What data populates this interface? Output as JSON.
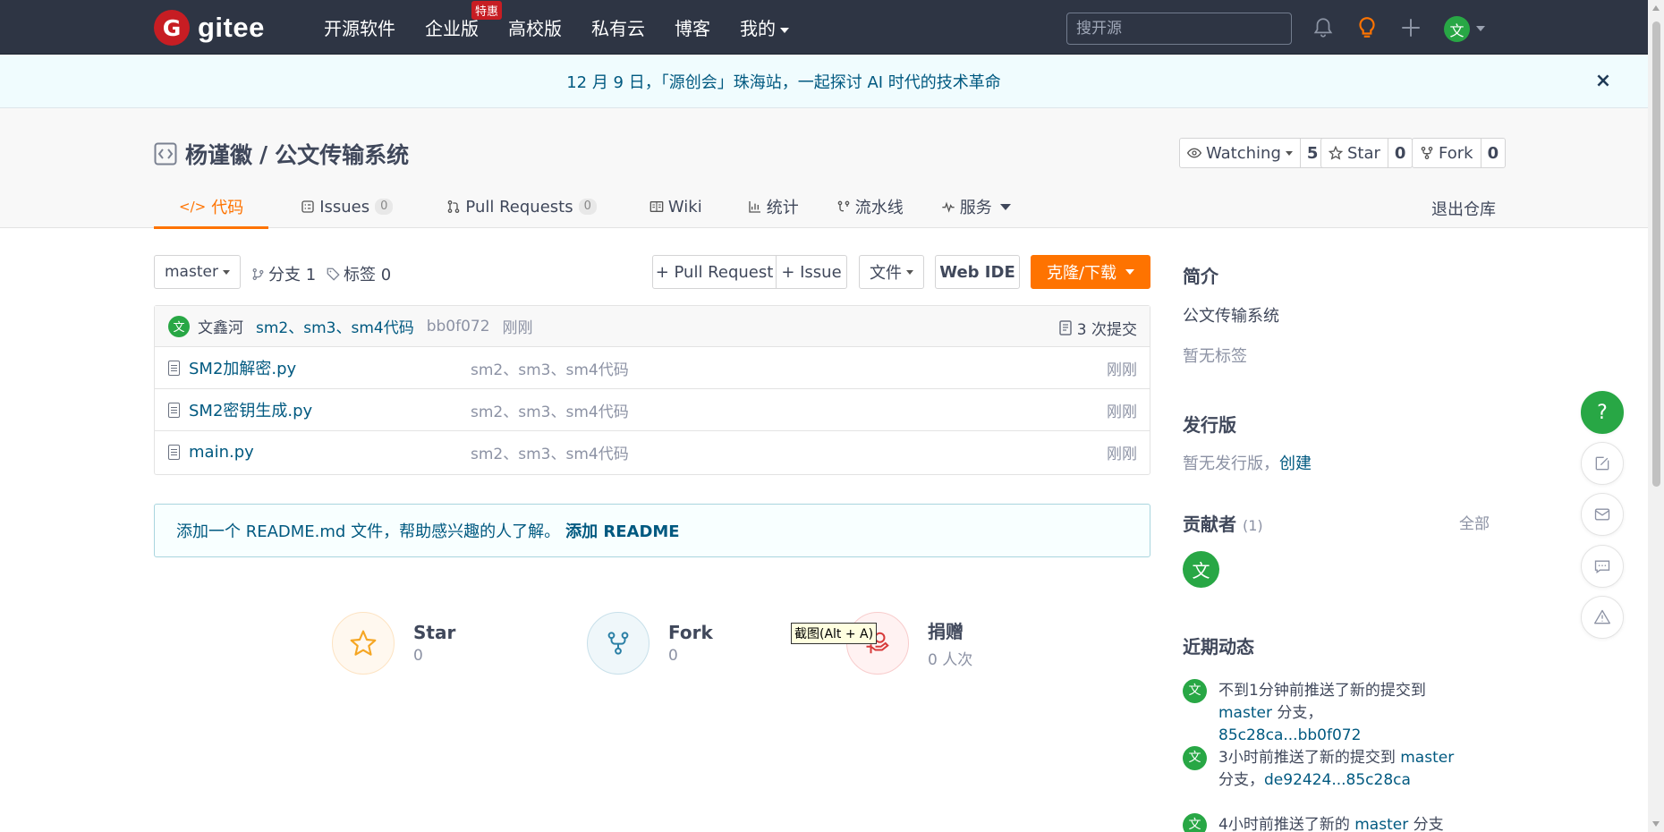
{
  "brand": {
    "logo_letter": "G",
    "name": "gitee"
  },
  "nav": {
    "items": [
      "开源软件",
      "企业版",
      "高校版",
      "私有云",
      "博客",
      "我的"
    ],
    "enterprise_badge": "特惠",
    "search_placeholder": "搜开源",
    "user_avatar": "文"
  },
  "banner": {
    "text": "12 月 9 日，「源创会」珠海站，一起探讨 AI 时代的技术革命",
    "close": "×"
  },
  "repo": {
    "owner": "杨谨徽",
    "separator": "/",
    "name": "公文传输系统",
    "watch": {
      "label": "Watching",
      "count": "5"
    },
    "star": {
      "label": "Star",
      "count": "0"
    },
    "fork": {
      "label": "Fork",
      "count": "0"
    }
  },
  "tabs": [
    {
      "label": "代码",
      "icon": "code-icon",
      "active": true
    },
    {
      "label": "Issues",
      "badge": "0",
      "icon": "issues-icon"
    },
    {
      "label": "Pull Requests",
      "badge": "0",
      "icon": "pull-request-icon"
    },
    {
      "label": "Wiki",
      "icon": "book-icon"
    },
    {
      "label": "统计",
      "icon": "bar-chart-icon"
    },
    {
      "label": "流水线",
      "icon": "pipeline-icon"
    },
    {
      "label": "服务",
      "icon": "pulse-icon"
    }
  ],
  "exit_repo": "退出仓库",
  "toolbar": {
    "branch": "master",
    "branches": "分支 1",
    "tags": "标签 0",
    "pull_request": "+ Pull Request",
    "issue": "+ Issue",
    "file": "文件",
    "web_ide": "Web IDE",
    "clone": "克隆/下载"
  },
  "commit": {
    "avatar": "文",
    "author": "文鑫河",
    "message": "sm2、sm3、sm4代码",
    "hash": "bb0f072",
    "time": "刚刚",
    "count": "3 次提交"
  },
  "files": [
    {
      "name": "SM2加解密.py",
      "message": "sm2、sm3、sm4代码",
      "time": "刚刚"
    },
    {
      "name": "SM2密钥生成.py",
      "message": "sm2、sm3、sm4代码",
      "time": "刚刚"
    },
    {
      "name": "main.py",
      "message": "sm2、sm3、sm4代码",
      "time": "刚刚"
    }
  ],
  "readme": {
    "text": "添加一个 README.md 文件，帮助感兴趣的人了解。",
    "link": "添加 README"
  },
  "stats": [
    {
      "label": "Star",
      "value": "0"
    },
    {
      "label": "Fork",
      "value": "0"
    },
    {
      "label": "捐赠",
      "value": "0 人次"
    }
  ],
  "tooltip": "截图(Alt + A)",
  "sidebar": {
    "intro_title": "简介",
    "intro_text": "公文传输系统",
    "no_tags": "暂无标签",
    "release_title": "发行版",
    "no_release": "暂无发行版，",
    "create": "创建",
    "contributors_title": "贡献者",
    "contributors_count": "(1)",
    "all": "全部",
    "contributor_avatar": "文",
    "activity_title": "近期动态",
    "activity": [
      {
        "avatar": "文",
        "prefix": "不到1分钟前推送了新的提交到 ",
        "branch": "master",
        "middle": " 分支，",
        "range": "85c28ca...bb0f072"
      },
      {
        "avatar": "文",
        "prefix": "3小时前推送了新的提交到 ",
        "branch": "master",
        "middle": " 分支，",
        "range": "de92424...85c28ca"
      },
      {
        "avatar": "文",
        "prefix": "4小时前推送了新的 ",
        "branch": "master",
        "middle": " 分支",
        "range": ""
      }
    ]
  },
  "float": {
    "help": "?"
  }
}
